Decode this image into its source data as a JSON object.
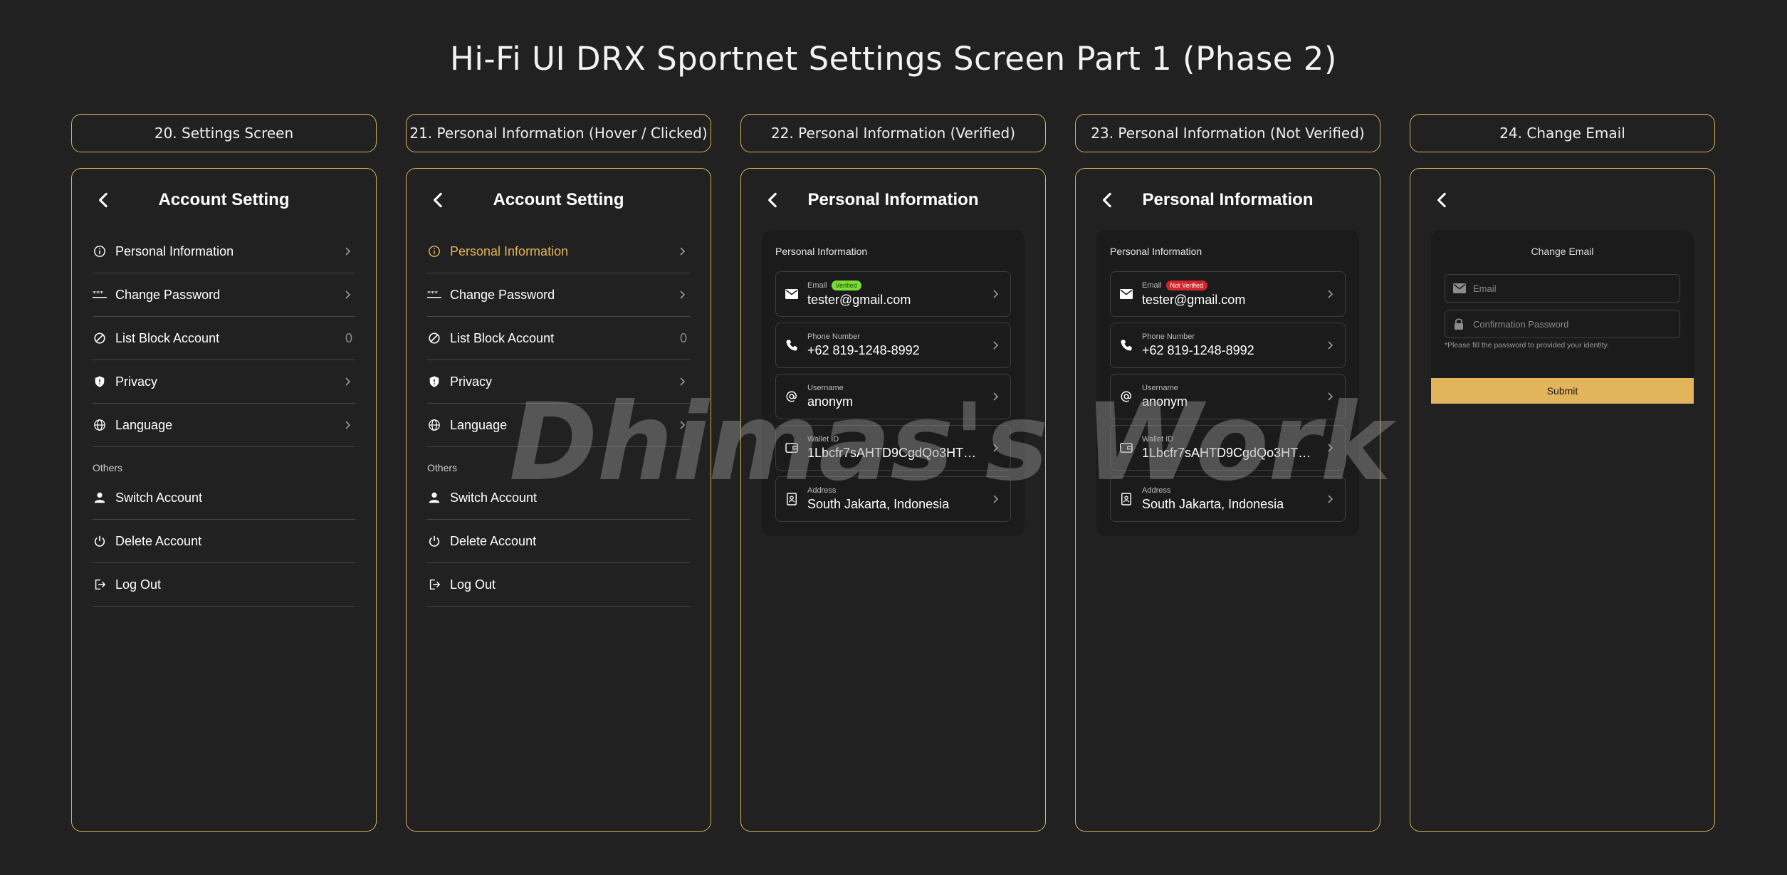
{
  "page_title": "Hi-Fi UI DRX Sportnet Settings Screen Part 1 (Phase 2)",
  "watermark": "Dhimas's Work",
  "accent_color": "#d2b05e",
  "highlight_color": "#e2b45c",
  "screens": [
    {
      "label": "20. Settings Screen",
      "title": "Account Setting"
    },
    {
      "label": "21. Personal Information (Hover / Clicked)",
      "title": "Account Setting"
    },
    {
      "label": "22. Personal Information (Verified)",
      "title": "Personal Information"
    },
    {
      "label": "23. Personal Information (Not Verified)",
      "title": "Personal Information"
    },
    {
      "label": "24. Change Email",
      "title": ""
    }
  ],
  "settings_menu": {
    "items": [
      {
        "label": "Personal Information",
        "icon": "info-icon"
      },
      {
        "label": "Change Password",
        "icon": "password-dots-icon"
      },
      {
        "label": "List Block Account",
        "icon": "block-icon",
        "count": "0"
      },
      {
        "label": "Privacy",
        "icon": "shield-icon"
      },
      {
        "label": "Language",
        "icon": "globe-icon"
      }
    ],
    "others_label": "Others",
    "others": [
      {
        "label": "Switch Account",
        "icon": "person-icon"
      },
      {
        "label": "Delete Account",
        "icon": "power-icon"
      },
      {
        "label": "Log Out",
        "icon": "logout-icon"
      }
    ]
  },
  "personal_info": {
    "card_title": "Personal Information",
    "email_label": "Email",
    "email_value": "tester@gmail.com",
    "verified_badge": "Verified",
    "not_verified_badge": "Not Verified",
    "phone_label": "Phone Number",
    "phone_value": "+62 819-1248-8992",
    "username_label": "Username",
    "username_value": "anonym",
    "wallet_label": "Wallet ID",
    "wallet_value": "1Lbcfr7sAHTD9CgdQo3HTM...",
    "address_label": "Address",
    "address_value": "South Jakarta, Indonesia"
  },
  "change_email": {
    "title": "Change Email",
    "email_placeholder": "Email",
    "password_placeholder": "Confirmation Password",
    "note": "*Please fill the password to provided your identity.",
    "submit_label": "Submit"
  }
}
